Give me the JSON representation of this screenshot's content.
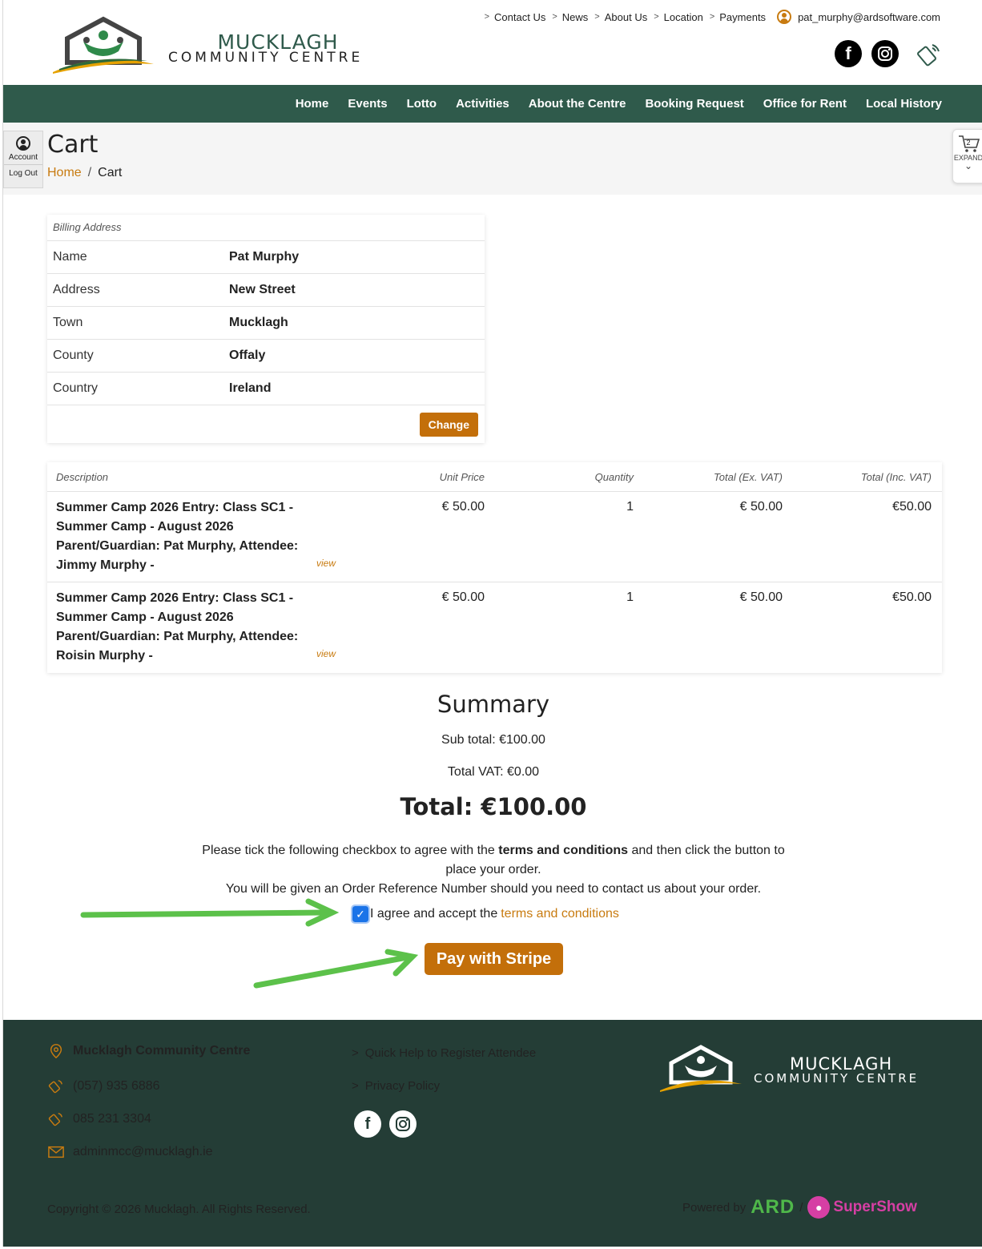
{
  "topbar": {
    "links": [
      "Contact Us",
      "News",
      "About Us",
      "Location",
      "Payments"
    ],
    "user_email": "pat_murphy@ardsoftware.com"
  },
  "brand": {
    "line1": "MUCKLAGH",
    "line2": "COMMUNITY CENTRE"
  },
  "social": {
    "facebook_icon": "facebook-icon",
    "instagram_icon": "instagram-icon",
    "phone_icon": "phone-icon"
  },
  "nav": [
    "Home",
    "Events",
    "Lotto",
    "Activities",
    "About the Centre",
    "Booking Request",
    "Office for Rent",
    "Local History"
  ],
  "account": {
    "account_label": "Account",
    "logout_label": "Log Out"
  },
  "page": {
    "title": "Cart",
    "breadcrumb_home": "Home",
    "breadcrumb_current": "Cart"
  },
  "cart_widget": {
    "count": "2",
    "label": "EXPAND"
  },
  "billing": {
    "header": "Billing Address",
    "rows": [
      {
        "label": "Name",
        "value": "Pat Murphy"
      },
      {
        "label": "Address",
        "value": "New Street"
      },
      {
        "label": "Town",
        "value": "Mucklagh"
      },
      {
        "label": "County",
        "value": "Offaly"
      },
      {
        "label": "Country",
        "value": "Ireland"
      }
    ],
    "change_label": "Change"
  },
  "order": {
    "columns": [
      "Description",
      "Unit Price",
      "Quantity",
      "Total (Ex. VAT)",
      "Total (Inc. VAT)"
    ],
    "rows": [
      {
        "desc_lines": [
          "Summer Camp 2026 Entry: Class SC1 -",
          "Summer Camp - August 2026",
          "Parent/Guardian: Pat Murphy, Attendee:",
          "Jimmy Murphy -"
        ],
        "view": "view",
        "unit": "€ 50.00",
        "qty": "1",
        "total_ex": "€ 50.00",
        "total_inc": "€50.00"
      },
      {
        "desc_lines": [
          "Summer Camp 2026 Entry: Class SC1 -",
          "Summer Camp - August 2026",
          "Parent/Guardian: Pat Murphy, Attendee:",
          "Roisin Murphy -"
        ],
        "view": "view",
        "unit": "€ 50.00",
        "qty": "1",
        "total_ex": "€ 50.00",
        "total_inc": "€50.00"
      }
    ]
  },
  "summary": {
    "title": "Summary",
    "subtotal": "Sub total: €100.00",
    "vat": "Total VAT: €0.00",
    "total": "Total: €100.00",
    "note_a": "Please tick the following checkbox to agree with the ",
    "note_b": "terms and conditions",
    "note_c": " and then click the button to place your order.",
    "note_d": "You will be given an Order Reference Number should you need to contact us about your order.",
    "agree_text": "I agree and accept the",
    "agree_link": "terms and conditions",
    "agree_checked": true,
    "pay_label": "Pay with Stripe"
  },
  "footer": {
    "org": "Mucklagh Community Centre",
    "phone1": "(057) 935 6886",
    "phone2": "085 231 3304",
    "email": "adminmcc@mucklagh.ie",
    "links": [
      "Quick Help to Register Attendee",
      "Privacy Policy"
    ],
    "copyright": "Copyright © 2026 Mucklagh. All Rights Reserved.",
    "powered_by": "Powered by",
    "ard": "ARD",
    "slash": "/",
    "supershow": "SuperShow"
  },
  "colors": {
    "green": "#2f5a4b",
    "footer": "#243d36",
    "accent": "#c36f0a",
    "annotation_arrow": "#5cc14a"
  }
}
